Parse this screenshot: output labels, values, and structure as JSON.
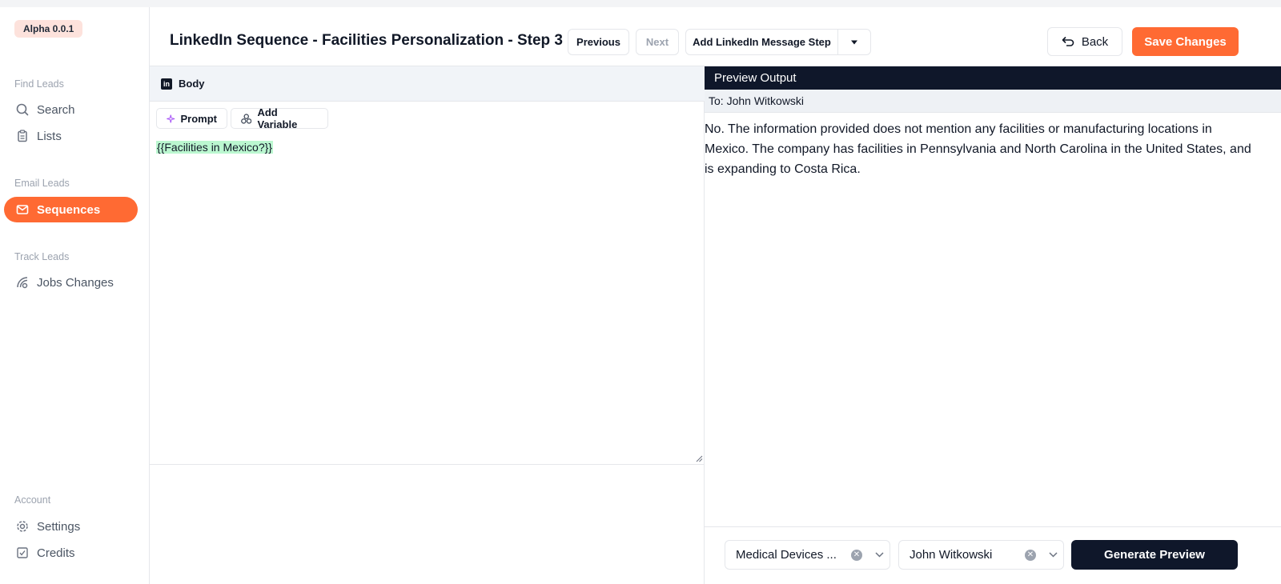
{
  "sidebar": {
    "version": "Alpha 0.0.1",
    "sections": [
      {
        "title": "Find Leads",
        "items": [
          {
            "label": "Search",
            "icon": "search-icon"
          },
          {
            "label": "Lists",
            "icon": "clipboard-icon"
          }
        ]
      },
      {
        "title": "Email Leads",
        "items": [
          {
            "label": "Sequences",
            "icon": "mail-icon",
            "active": true
          }
        ]
      },
      {
        "title": "Track Leads",
        "items": [
          {
            "label": "Jobs Changes",
            "icon": "signal-icon"
          }
        ]
      },
      {
        "title": "Account",
        "items": [
          {
            "label": "Settings",
            "icon": "gear-icon"
          },
          {
            "label": "Credits",
            "icon": "checkbox-icon"
          }
        ]
      }
    ]
  },
  "header": {
    "title": "LinkedIn Sequence - Facilities Personalization - Step 3",
    "previous_label": "Previous",
    "next_label": "Next",
    "add_step_label": "Add LinkedIn Message Step",
    "back_label": "Back",
    "save_label": "Save Changes"
  },
  "editor": {
    "section_label": "Body",
    "prompt_label": "Prompt",
    "add_variable_label": "Add Variable",
    "content": "{{Facilities in Mexico?}}"
  },
  "preview": {
    "title": "Preview Output",
    "to": "To: John Witkowski",
    "output": "No. The information provided does not mention any facilities or manufacturing locations in Mexico. The company has facilities in Pennsylvania and North Carolina in the United States, and is expanding to Costa Rica.",
    "list_select": "Medical Devices ...",
    "contact_select": "John Witkowski",
    "generate_label": "Generate Preview"
  },
  "colors": {
    "accent": "#ff6a33",
    "dark": "#0f172a",
    "variable_highlight": "#bbf7d0"
  }
}
